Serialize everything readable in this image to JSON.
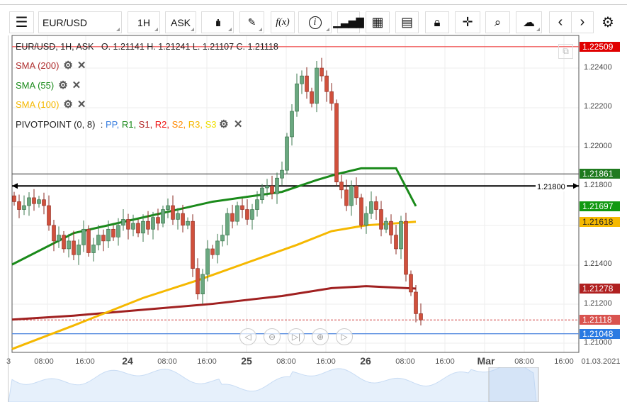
{
  "toolbar": {
    "menu_icon": "hamburger-icon",
    "symbol": "EUR/USD",
    "timeframe": "1H",
    "price_type": "ASK",
    "icons": [
      "candlestick-type-icon",
      "pencil-icon",
      "function-icon",
      "info-icon",
      "bar-chart-icon",
      "calendar-icon",
      "report-icon",
      "lock-icon",
      "crosshair-icon",
      "zoom-search-icon",
      "cloud-upload-icon",
      "chevron-left-icon",
      "chevron-right-icon",
      "gear-icon"
    ],
    "fx_label": "f(x)",
    "info_label": "i"
  },
  "header": {
    "ohlc": "EUR/USD, 1H, ASK   O. 1.21141 H. 1.21241 L. 1.21107 C. 1.21118"
  },
  "indicators": [
    {
      "label": "SMA (200)",
      "color": "#b03030"
    },
    {
      "label": "SMA (55)",
      "color": "#1a8a1a"
    },
    {
      "label": "SMA (100)",
      "color": "#f5b800"
    }
  ],
  "pivot": {
    "label": "PIVOTPOINT (0, 8)",
    "sep": ":",
    "items": [
      {
        "t": "PP",
        "c": "#3a7fe0"
      },
      {
        "t": "R1",
        "c": "#1a8a1a"
      },
      {
        "t": "S1",
        "c": "#b02020"
      },
      {
        "t": "R2",
        "c": "#ee1111"
      },
      {
        "t": "S2",
        "c": "#ff8800"
      },
      {
        "t": "R3",
        "c": "#f5b800"
      },
      {
        "t": "S3",
        "c": "#f0e000"
      }
    ]
  },
  "price_axis": {
    "labels": [
      "1.22400",
      "1.22200",
      "1.22000",
      "1.21800",
      "1.21400",
      "1.21200",
      "1.21000"
    ],
    "badges": [
      {
        "v": "1.22509",
        "c": "#e00000"
      },
      {
        "v": "1.21861",
        "c": "#1f7a1f"
      },
      {
        "v": "1.21697",
        "c": "#119911"
      },
      {
        "v": "1.21618",
        "c": "#f5b800"
      },
      {
        "v": "1.21278",
        "c": "#b02020"
      },
      {
        "v": "1.21118",
        "c": "#d9534f"
      },
      {
        "v": "1.21048",
        "c": "#2a7ae2"
      }
    ]
  },
  "hline_label": "1.21800",
  "time_axis": {
    "labels": [
      "3",
      "08:00",
      "16:00",
      "24",
      "08:00",
      "16:00",
      "25",
      "08:00",
      "16:00",
      "26",
      "08:00",
      "16:00",
      "Mar",
      "08:00",
      "16:00",
      "01.03.2021"
    ]
  },
  "nav_buttons": [
    "scroll-left-icon",
    "zoom-out-icon",
    "go-to-end-icon",
    "zoom-in-icon",
    "scroll-right-icon"
  ],
  "chart_data": {
    "type": "candlestick",
    "symbol": "EUR/USD",
    "timeframe": "1H",
    "closes": [
      1.2172,
      1.2168,
      1.217,
      1.2174,
      1.2171,
      1.2173,
      1.217,
      1.216,
      1.2152,
      1.2155,
      1.2148,
      1.2152,
      1.2145,
      1.215,
      1.2158,
      1.2146,
      1.215,
      1.2155,
      1.2152,
      1.2158,
      1.2154,
      1.216,
      1.2163,
      1.2158,
      1.2161,
      1.2156,
      1.2162,
      1.2158,
      1.2164,
      1.2161,
      1.2168,
      1.217,
      1.2163,
      1.2166,
      1.216,
      1.2162,
      1.2138,
      1.2125,
      1.2135,
      1.2148,
      1.2145,
      1.2152,
      1.2155,
      1.2166,
      1.2162,
      1.217,
      1.2168,
      1.2163,
      1.2168,
      1.2173,
      1.2179,
      1.218,
      1.2176,
      1.2184,
      1.2188,
      1.2205,
      1.2218,
      1.2232,
      1.2236,
      1.2228,
      1.2222,
      1.224,
      1.2236,
      1.2228,
      1.2222,
      1.2182,
      1.2178,
      1.217,
      1.218,
      1.2174,
      1.216,
      1.2166,
      1.2172,
      1.2168,
      1.2158,
      1.2162,
      1.2155,
      1.2148,
      1.2162,
      1.2135,
      1.2126,
      1.2115,
      1.21118
    ],
    "sma200": [
      [
        0,
        1.2112
      ],
      [
        12,
        1.2114
      ],
      [
        26,
        1.2117
      ],
      [
        40,
        1.212
      ],
      [
        54,
        1.2124
      ],
      [
        64,
        1.2128
      ],
      [
        71,
        1.2129
      ],
      [
        81,
        1.21278
      ]
    ],
    "sma55": [
      [
        0,
        1.214
      ],
      [
        12,
        1.2156
      ],
      [
        26,
        1.2164
      ],
      [
        40,
        1.2172
      ],
      [
        54,
        1.2177
      ],
      [
        61,
        1.2183
      ],
      [
        65,
        1.2186
      ],
      [
        70,
        1.2189
      ],
      [
        77,
        1.2189
      ],
      [
        81,
        1.21697
      ]
    ],
    "sma100": [
      [
        0,
        1.2097
      ],
      [
        12,
        1.2109
      ],
      [
        26,
        1.2123
      ],
      [
        37,
        1.2132
      ],
      [
        47,
        1.2141
      ],
      [
        57,
        1.215
      ],
      [
        64,
        1.2157
      ],
      [
        71,
        1.216
      ],
      [
        77,
        1.2161
      ],
      [
        81,
        1.21618
      ]
    ],
    "hlines": [
      {
        "v": 1.22509,
        "c": "#f06060"
      },
      {
        "v": 1.21861,
        "c": "#555"
      },
      {
        "v": 1.218,
        "c": "#000"
      },
      {
        "v": 1.21048,
        "c": "#5b8fe0"
      }
    ],
    "last": 1.21118,
    "ylim": [
      1.2097,
      1.2268
    ]
  }
}
